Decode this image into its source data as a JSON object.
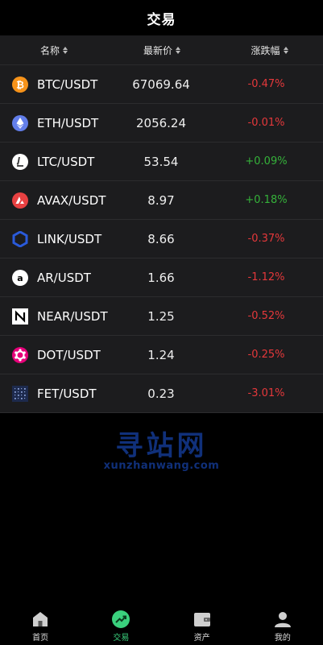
{
  "header": {
    "title": "交易"
  },
  "columns": {
    "name": "名称",
    "price": "最新价",
    "change": "涨跌幅"
  },
  "rows": [
    {
      "pair": "BTC/USDT",
      "price": "67069.64",
      "change": "-0.47%",
      "dir": "down",
      "icon": "btc-icon",
      "color": "#f7931a"
    },
    {
      "pair": "ETH/USDT",
      "price": "2056.24",
      "change": "-0.01%",
      "dir": "down",
      "icon": "eth-icon",
      "color": "#627eea"
    },
    {
      "pair": "LTC/USDT",
      "price": "53.54",
      "change": "+0.09%",
      "dir": "up",
      "icon": "ltc-icon",
      "color": "#ffffff"
    },
    {
      "pair": "AVAX/USDT",
      "price": "8.97",
      "change": "+0.18%",
      "dir": "up",
      "icon": "avax-icon",
      "color": "#e84142"
    },
    {
      "pair": "LINK/USDT",
      "price": "8.66",
      "change": "-0.37%",
      "dir": "down",
      "icon": "link-icon",
      "color": "#2a5ada"
    },
    {
      "pair": "AR/USDT",
      "price": "1.66",
      "change": "-1.12%",
      "dir": "down",
      "icon": "ar-icon",
      "color": "#ffffff"
    },
    {
      "pair": "NEAR/USDT",
      "price": "1.25",
      "change": "-0.52%",
      "dir": "down",
      "icon": "near-icon",
      "color": "#ffffff"
    },
    {
      "pair": "DOT/USDT",
      "price": "1.24",
      "change": "-0.25%",
      "dir": "down",
      "icon": "dot-icon",
      "color": "#e6007a"
    },
    {
      "pair": "FET/USDT",
      "price": "0.23",
      "change": "-3.01%",
      "dir": "down",
      "icon": "fet-icon",
      "color": "#1d2a4d"
    }
  ],
  "watermark": {
    "big": "寻站网",
    "small": "xunzhanwang.com"
  },
  "tabs": [
    {
      "label": "首页",
      "icon": "home-icon",
      "active": false
    },
    {
      "label": "交易",
      "icon": "trend-icon",
      "active": true
    },
    {
      "label": "资产",
      "icon": "wallet-icon",
      "active": false
    },
    {
      "label": "我的",
      "icon": "user-icon",
      "active": false
    }
  ],
  "colors": {
    "up": "#35b23a",
    "down": "#e5383b",
    "accent": "#3ad07d"
  }
}
